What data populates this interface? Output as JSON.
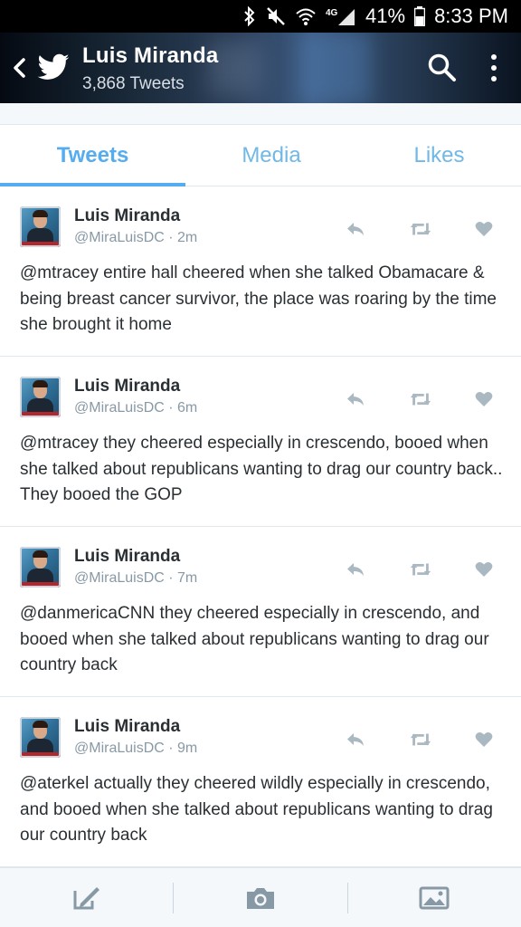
{
  "status_bar": {
    "battery": "41%",
    "time": "8:33 PM",
    "network": "4G",
    "icons": [
      "bluetooth-icon",
      "mute-icon",
      "wifi-icon",
      "signal-icon",
      "battery-icon"
    ]
  },
  "header": {
    "title": "Luis Miranda",
    "subtitle": "3,868 Tweets",
    "icons": [
      "back-icon",
      "twitter-bird-icon",
      "search-icon",
      "more-vert-icon"
    ]
  },
  "tabs": [
    {
      "label": "Tweets",
      "active": true
    },
    {
      "label": "Media",
      "active": false
    },
    {
      "label": "Likes",
      "active": false
    }
  ],
  "tweets": [
    {
      "name": "Luis Miranda",
      "meta": "@MiraLuisDC · 2m",
      "text": "@mtracey entire hall cheered when she talked Obamacare & being breast cancer survivor, the place was roaring by the time she brought it home"
    },
    {
      "name": "Luis Miranda",
      "meta": "@MiraLuisDC · 6m",
      "text": "@mtracey they cheered especially in crescendo, booed when she talked about republicans wanting to drag our country back.. They booed the GOP"
    },
    {
      "name": "Luis Miranda",
      "meta": "@MiraLuisDC · 7m",
      "text": "@danmericaCNN they cheered especially in crescendo, and booed when she talked about republicans wanting to drag our country back"
    },
    {
      "name": "Luis Miranda",
      "meta": "@MiraLuisDC · 9m",
      "text": "@aterkel actually they cheered wildly especially in crescendo, and booed when she talked about republicans wanting to drag our country back"
    }
  ],
  "bottom_bar": {
    "icons": [
      "compose-icon",
      "camera-icon",
      "image-icon"
    ]
  },
  "colors": {
    "accent": "#55acee",
    "tab_inactive": "#70b8e6",
    "text": "#292f33",
    "muted": "#8899a6",
    "action_icon": "#aab8c2"
  }
}
